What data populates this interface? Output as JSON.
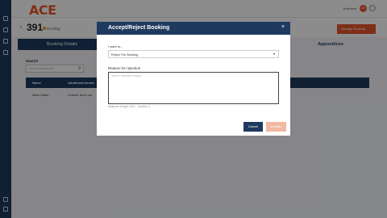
{
  "app": {
    "logo_text": "ACE"
  },
  "topbar": {
    "user_label": "Business",
    "avatar_initials": "AB",
    "help_icon": "question-icon"
  },
  "sidebar": {
    "icons": [
      "dashboard-icon",
      "calendar-icon",
      "people-icon",
      "reports-icon",
      "trash-icon",
      "settings-icon"
    ]
  },
  "header": {
    "back_icon": "chevron-left-icon",
    "booking_number": "391",
    "status": "Pending",
    "manage_button": "Manage Booking"
  },
  "tabs": {
    "booking_details": "Booking Details",
    "apprentices": "Apprentices"
  },
  "search": {
    "label": "Search",
    "placeholder": "Search Apprentices"
  },
  "table": {
    "headers": [
      "Name",
      "Additional Needs"
    ],
    "rows": [
      {
        "name": "Mark Hales",
        "needs": "Learner does not"
      }
    ]
  },
  "modal": {
    "title": "Accept/Reject Booking",
    "close_label": "×",
    "want_label": "I want to...",
    "select_value": "Reject The Booking",
    "reason_label": "Reason for rejection",
    "reason_placeholder": "Type in rejection reason",
    "hint": "Minimum length: 5/10 - Limited: 0",
    "cancel": "Cancel",
    "confirm": "Confirm"
  },
  "colors": {
    "brand": "#e8562a",
    "navy": "#1f3a5f"
  }
}
